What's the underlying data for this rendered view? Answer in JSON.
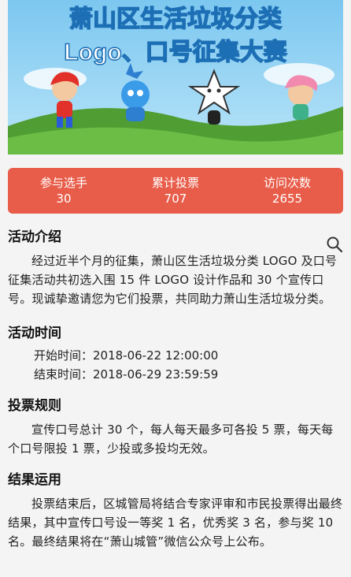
{
  "banner": {
    "title_line1": "萧山区生活垃圾分类",
    "title_line2": "Logo、口号征集大赛"
  },
  "stats": [
    {
      "label": "参与选手",
      "value": "30"
    },
    {
      "label": "累计投票",
      "value": "707"
    },
    {
      "label": "访问次数",
      "value": "2655"
    }
  ],
  "intro": {
    "title": "活动介绍",
    "text": "经过近半个月的征集，萧山区生活垃圾分类 LOGO 及口号征集活动共初选入围 15 件 LOGO 设计作品和 30 个宣传口号。现诚挚邀请您为它们投票，共同助力萧山生活垃圾分类。"
  },
  "time": {
    "title": "活动时间",
    "start": "开始时间：2018-06-22 12:00:00",
    "end": "结束时间：2018-06-29 23:59:59"
  },
  "rules": {
    "title": "投票规则",
    "text": "宣传口号总计 30 个，每人每天最多可各投 5 票，每天每个口号限投 1 票，少投或多投均无效。"
  },
  "results": {
    "title": "结果运用",
    "text": "投票结束后，区城管局将结合专家评审和市民投票得出最终结果，其中宣传口号设一等奖 1 名，优秀奖 3 名，参与奖 10 名。最终结果将在“萧山城管”微信公众号上公布。"
  },
  "colors": {
    "stats_bg": "#e85d4a",
    "banner_sky": "#8fd0f2",
    "banner_grass": "#5cae3c"
  },
  "icons": {
    "search": "search-icon"
  }
}
